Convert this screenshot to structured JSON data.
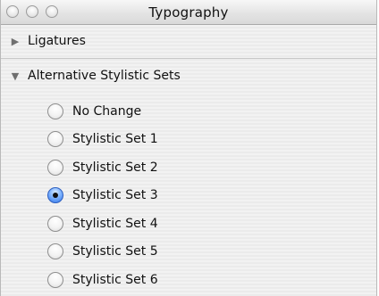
{
  "window": {
    "title": "Typography"
  },
  "sections": {
    "ligatures": {
      "label": "Ligatures",
      "expanded": false,
      "disclosure_icon": "triangle-right-icon"
    },
    "alternative_stylistic_sets": {
      "label": "Alternative Stylistic Sets",
      "expanded": true,
      "disclosure_icon": "triangle-down-icon",
      "options": [
        {
          "label": "No Change",
          "selected": false
        },
        {
          "label": "Stylistic Set 1",
          "selected": false
        },
        {
          "label": "Stylistic Set 2",
          "selected": false
        },
        {
          "label": "Stylistic Set 3",
          "selected": true
        },
        {
          "label": "Stylistic Set 4",
          "selected": false
        },
        {
          "label": "Stylistic Set 5",
          "selected": false
        },
        {
          "label": "Stylistic Set 6",
          "selected": false
        }
      ]
    }
  },
  "colors": {
    "selected_radio": "#2f73e6",
    "panel_stripe_light": "#f2f2f2",
    "panel_stripe_dark": "#ebebeb"
  }
}
